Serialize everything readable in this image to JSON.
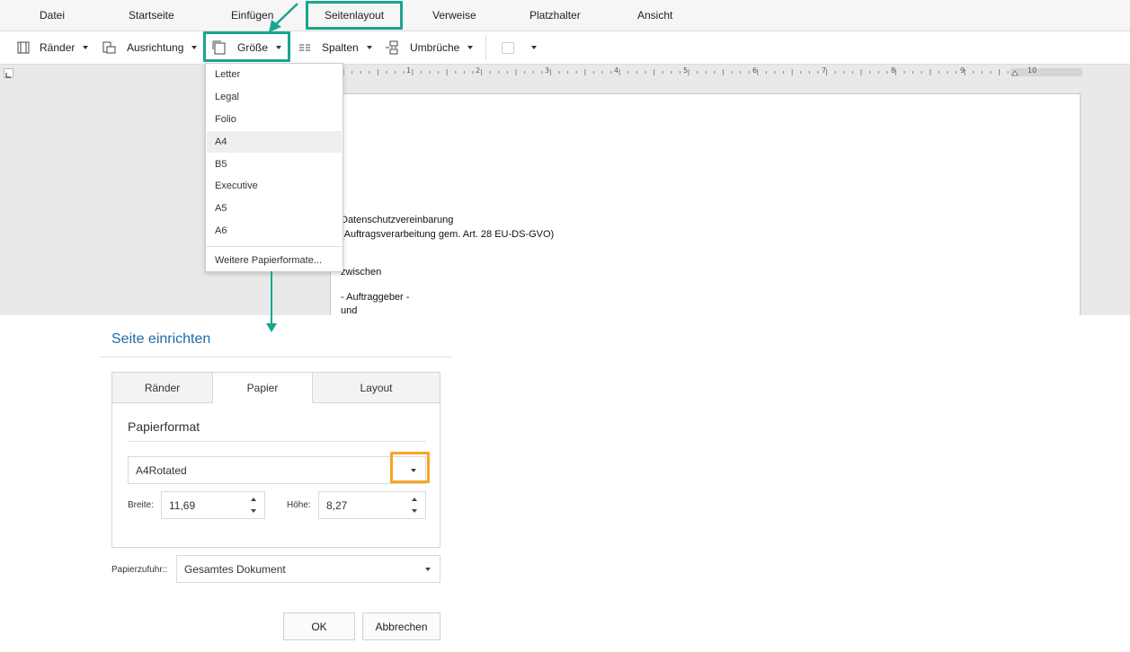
{
  "colors": {
    "highlight_green": "#1aa58d",
    "highlight_orange": "#f5a623",
    "dialog_title": "#1e6ba8"
  },
  "menu": {
    "items": [
      "Datei",
      "Startseite",
      "Einfügen",
      "Seitenlayout",
      "Verweise",
      "Platzhalter",
      "Ansicht"
    ],
    "active": "Seitenlayout"
  },
  "toolbar": {
    "margins": {
      "label": "Ränder",
      "icon": "margins-icon"
    },
    "orientation": {
      "label": "Ausrichtung",
      "icon": "orientation-icon"
    },
    "size": {
      "label": "Größe",
      "icon": "page-size-icon"
    },
    "columns": {
      "label": "Spalten",
      "icon": "columns-icon"
    },
    "breaks": {
      "label": "Umbrüche",
      "icon": "page-break-icon"
    },
    "page_color": {
      "icon": "page-color-icon"
    }
  },
  "ruler": {
    "numbers": [
      "1",
      "2",
      "3",
      "4",
      "5",
      "6",
      "7",
      "8",
      "9",
      "10"
    ]
  },
  "size_dropdown": {
    "items": [
      "Letter",
      "Legal",
      "Folio",
      "A4",
      "B5",
      "Executive",
      "A5",
      "A6"
    ],
    "highlighted": "A4",
    "more_label": "Weitere Papierformate..."
  },
  "document": {
    "lines": [
      "Datenschutzvereinbarung",
      "(Auftragsverarbeitung gem. Art. 28 EU-DS-GVO)",
      "zwischen",
      "- Auftraggeber -",
      "und"
    ]
  },
  "dialog": {
    "title": "Seite einrichten",
    "tabs": [
      "Ränder",
      "Papier",
      "Layout"
    ],
    "active_tab": "Papier",
    "section_heading": "Papierformat",
    "paper_format_value": "A4Rotated",
    "width_label": "Breite:",
    "width_value": "11,69",
    "height_label": "Höhe:",
    "height_value": "8,27",
    "paper_source_label": "Papierzufuhr::",
    "paper_source_value": "Gesamtes Dokument",
    "ok_label": "OK",
    "cancel_label": "Abbrechen"
  }
}
